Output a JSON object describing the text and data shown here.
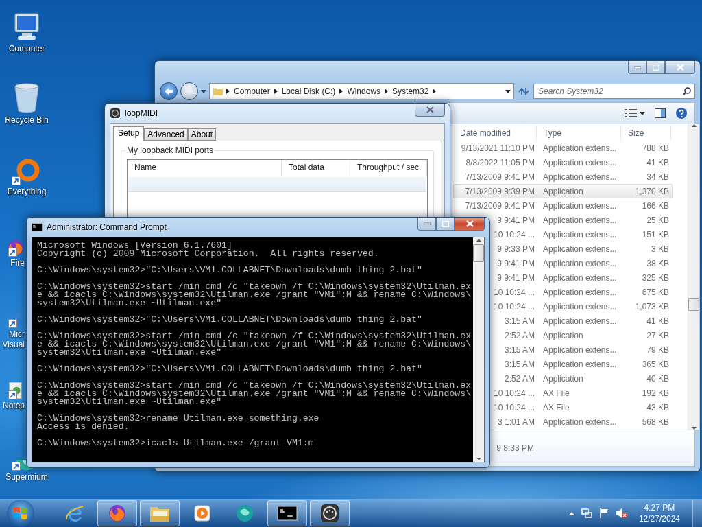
{
  "desktop_icons": [
    {
      "label": "Computer",
      "kind": "computer",
      "shortcut": false,
      "clipped": false
    },
    {
      "label": "Recycle Bin",
      "kind": "recycle",
      "shortcut": false,
      "clipped": false
    },
    {
      "label": "Everything",
      "kind": "everything",
      "shortcut": true,
      "clipped": false
    },
    {
      "label": "Fire",
      "kind": "firefox",
      "shortcut": true,
      "clipped": true
    },
    {
      "label": "Micr Visual",
      "kind": "visual",
      "shortcut": true,
      "clipped": true
    },
    {
      "label": "Notep",
      "kind": "notepad",
      "shortcut": true,
      "clipped": true
    },
    {
      "label": "Supermium",
      "kind": "supermium",
      "shortcut": true,
      "clipped": false
    }
  ],
  "explorer": {
    "breadcrumb": [
      "Computer",
      "Local Disk (C:)",
      "Windows",
      "System32"
    ],
    "search": {
      "placeholder": "Search System32"
    },
    "columns": [
      "Date modified",
      "Type",
      "Size"
    ],
    "rows": [
      {
        "date": "9/13/2021 11:10 PM",
        "type": "Application extens...",
        "size": "788 KB",
        "selected": false
      },
      {
        "date": "8/8/2022 11:05 PM",
        "type": "Application extens...",
        "size": "41 KB",
        "selected": false
      },
      {
        "date": "7/13/2009 9:41 PM",
        "type": "Application extens...",
        "size": "34 KB",
        "selected": false
      },
      {
        "date": "7/13/2009 9:39 PM",
        "type": "Application",
        "size": "1,370 KB",
        "selected": true
      },
      {
        "date": "7/13/2009 9:41 PM",
        "type": "Application extens...",
        "size": "166 KB",
        "selected": false
      },
      {
        "date": "9 9:41 PM",
        "type": "Application extens...",
        "size": "25 KB",
        "selected": false
      },
      {
        "date": "10 10:24 ...",
        "type": "Application extens...",
        "size": "151 KB",
        "selected": false
      },
      {
        "date": "9 9:33 PM",
        "type": "Application extens...",
        "size": "3 KB",
        "selected": false
      },
      {
        "date": "9 9:41 PM",
        "type": "Application extens...",
        "size": "38 KB",
        "selected": false
      },
      {
        "date": "9 9:41 PM",
        "type": "Application extens...",
        "size": "325 KB",
        "selected": false
      },
      {
        "date": "10 10:24 ...",
        "type": "Application extens...",
        "size": "675 KB",
        "selected": false
      },
      {
        "date": "10 10:24 ...",
        "type": "Application extens...",
        "size": "1,073 KB",
        "selected": false
      },
      {
        "date": "3:15 AM",
        "type": "Application extens...",
        "size": "41 KB",
        "selected": false
      },
      {
        "date": "2:52 AM",
        "type": "Application",
        "size": "27 KB",
        "selected": false
      },
      {
        "date": "3:15 AM",
        "type": "Application extens...",
        "size": "79 KB",
        "selected": false
      },
      {
        "date": "3:15 AM",
        "type": "Application extens...",
        "size": "365 KB",
        "selected": false
      },
      {
        "date": "2:52 AM",
        "type": "Application",
        "size": "40 KB",
        "selected": false
      },
      {
        "date": "10 10:24 ...",
        "type": "AX File",
        "size": "192 KB",
        "selected": false
      },
      {
        "date": "10 10:24 ...",
        "type": "AX File",
        "size": "43 KB",
        "selected": false
      },
      {
        "date": "3 1:01 AM",
        "type": "Application extens...",
        "size": "568 KB",
        "selected": false
      }
    ],
    "details_pane": {
      "text": "9 8:33 PM"
    }
  },
  "loopmidi": {
    "title": "loopMIDI",
    "tabs": [
      {
        "label": "Setup",
        "selected": true
      },
      {
        "label": "Advanced",
        "selected": false
      },
      {
        "label": "About",
        "selected": false
      }
    ],
    "group_title": "My loopback MIDI ports",
    "columns": [
      "Name",
      "Total data",
      "Throughput / sec."
    ]
  },
  "cmd": {
    "title": "Administrator: Command Prompt",
    "blocks": [
      [
        "Microsoft Windows [Version 6.1.7601]",
        "Copyright (c) 2009 Microsoft Corporation.  All rights reserved."
      ],
      [
        "C:\\Windows\\system32>\"C:\\Users\\VM1.COLLABNET\\Downloads\\dumb thing 2.bat\""
      ],
      [
        "C:\\Windows\\system32>start /min cmd /c \"takeown /f C:\\Windows\\system32\\Utilman.ex",
        "e && icacls C:\\Windows\\system32\\Utilman.exe /grant \"VM1\":M && rename C:\\Windows\\",
        "system32\\Utilman.exe ~Utilman.exe\""
      ],
      [
        "C:\\Windows\\system32>\"C:\\Users\\VM1.COLLABNET\\Downloads\\dumb thing 2.bat\""
      ],
      [
        "C:\\Windows\\system32>start /min cmd /c \"takeown /f C:\\Windows\\system32\\Utilman.ex",
        "e && icacls C:\\Windows\\system32\\Utilman.exe /grant \"VM1\":M && rename C:\\Windows\\",
        "system32\\Utilman.exe ~Utilman.exe\""
      ],
      [
        "C:\\Windows\\system32>\"C:\\Users\\VM1.COLLABNET\\Downloads\\dumb thing 2.bat\""
      ],
      [
        "C:\\Windows\\system32>start /min cmd /c \"takeown /f C:\\Windows\\system32\\Utilman.ex",
        "e && icacls C:\\Windows\\system32\\Utilman.exe /grant \"VM1\":M && rename C:\\Windows\\",
        "system32\\Utilman.exe ~Utilman.exe\""
      ],
      [
        "C:\\Windows\\system32>rename Utilman.exe something.exe",
        "Access is denied."
      ],
      [
        "C:\\Windows\\system32>icacls Utilman.exe /grant VM1:m"
      ]
    ]
  },
  "taskbar": {
    "items": [
      {
        "kind": "ie",
        "running": false
      },
      {
        "kind": "firefox",
        "running": true
      },
      {
        "kind": "explorer",
        "running": true
      },
      {
        "kind": "media",
        "running": false
      },
      {
        "kind": "chat",
        "running": false
      },
      {
        "kind": "cmd",
        "running": true
      },
      {
        "kind": "loopmidi",
        "running": true
      }
    ],
    "tray": {
      "volume_muted": true,
      "time": "4:27 PM",
      "date": "12/27/2024"
    }
  }
}
